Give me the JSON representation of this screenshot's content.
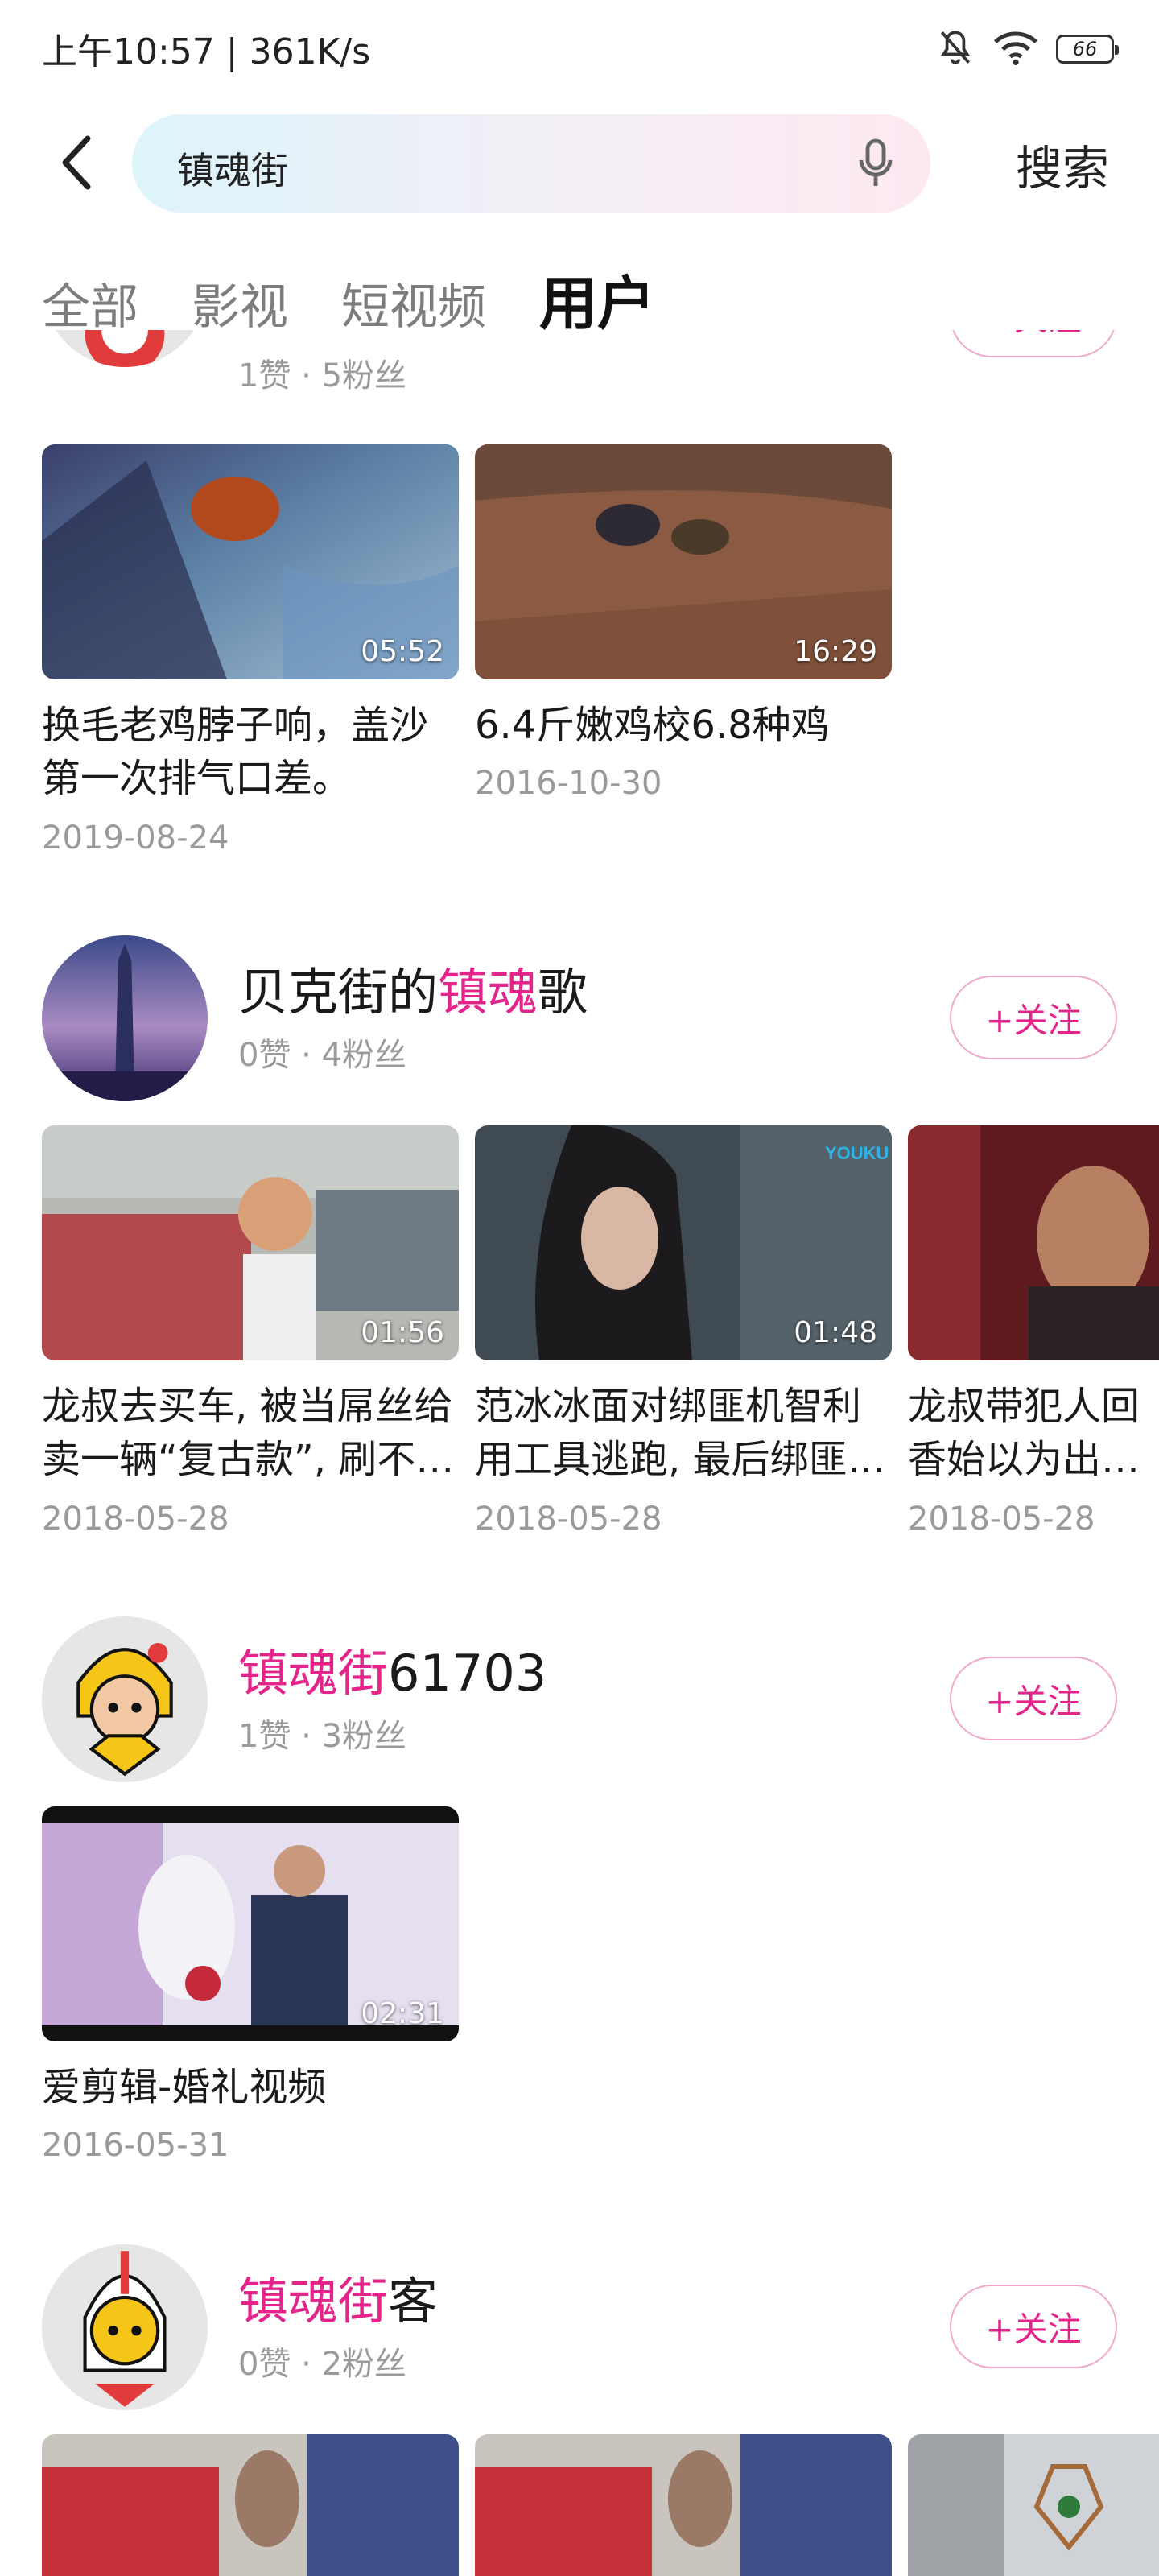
{
  "status_bar": {
    "time_speed": "上午10:57 | 361K/s",
    "battery": "66",
    "icons": [
      "mute-icon",
      "wifi-icon",
      "battery-icon"
    ]
  },
  "header": {
    "query": "镇魂街",
    "search_label": "搜索"
  },
  "tabs": [
    {
      "label": "全部",
      "active": false
    },
    {
      "label": "影视",
      "active": false
    },
    {
      "label": "短视频",
      "active": false
    },
    {
      "label": "用户",
      "active": true
    }
  ],
  "follow_label": "+关注",
  "users": [
    {
      "name_rest": "",
      "stats": "1赞 · 5粉丝",
      "videos": [
        {
          "title": "换毛老鸡脖子响，盖沙第一次排气口差。",
          "duration": "05:52",
          "date": "2019-08-24"
        },
        {
          "title": "6.4斤嫩鸡校6.8种鸡",
          "duration": "16:29",
          "date": "2016-10-30"
        }
      ]
    },
    {
      "name_pre": "贝克街的",
      "name_hl": "镇魂",
      "name_post": "歌",
      "stats": "0赞 · 4粉丝",
      "videos": [
        {
          "title": "龙叔去买车, 被当屌丝给卖一辆“复古款”, 刷不…",
          "duration": "01:56",
          "date": "2018-05-28"
        },
        {
          "title": "范冰冰面对绑匪机智利用工具逃跑, 最后绑匪…",
          "duration": "01:48",
          "date": "2018-05-28"
        },
        {
          "title": "龙叔带犯人回香始以为出行高端",
          "duration": "",
          "date": "2018-05-28"
        }
      ]
    },
    {
      "name_pre": "",
      "name_hl": "镇魂街",
      "name_post": "61703",
      "stats": "1赞 · 3粉丝",
      "videos": [
        {
          "title": "爱剪辑-婚礼视频",
          "duration": "02:31",
          "date": "2016-05-31"
        }
      ]
    },
    {
      "name_pre": "",
      "name_hl": "镇魂街",
      "name_post": "客",
      "stats": "0赞 · 2粉丝",
      "videos": [
        {
          "title": "",
          "duration": "",
          "date": ""
        },
        {
          "title": "",
          "duration": "",
          "date": ""
        },
        {
          "title": "",
          "duration": "",
          "date": ""
        }
      ]
    }
  ],
  "colors": {
    "accent": "#e5248b",
    "follow_border": "#f0a8cd",
    "muted": "#9a9a9a"
  }
}
